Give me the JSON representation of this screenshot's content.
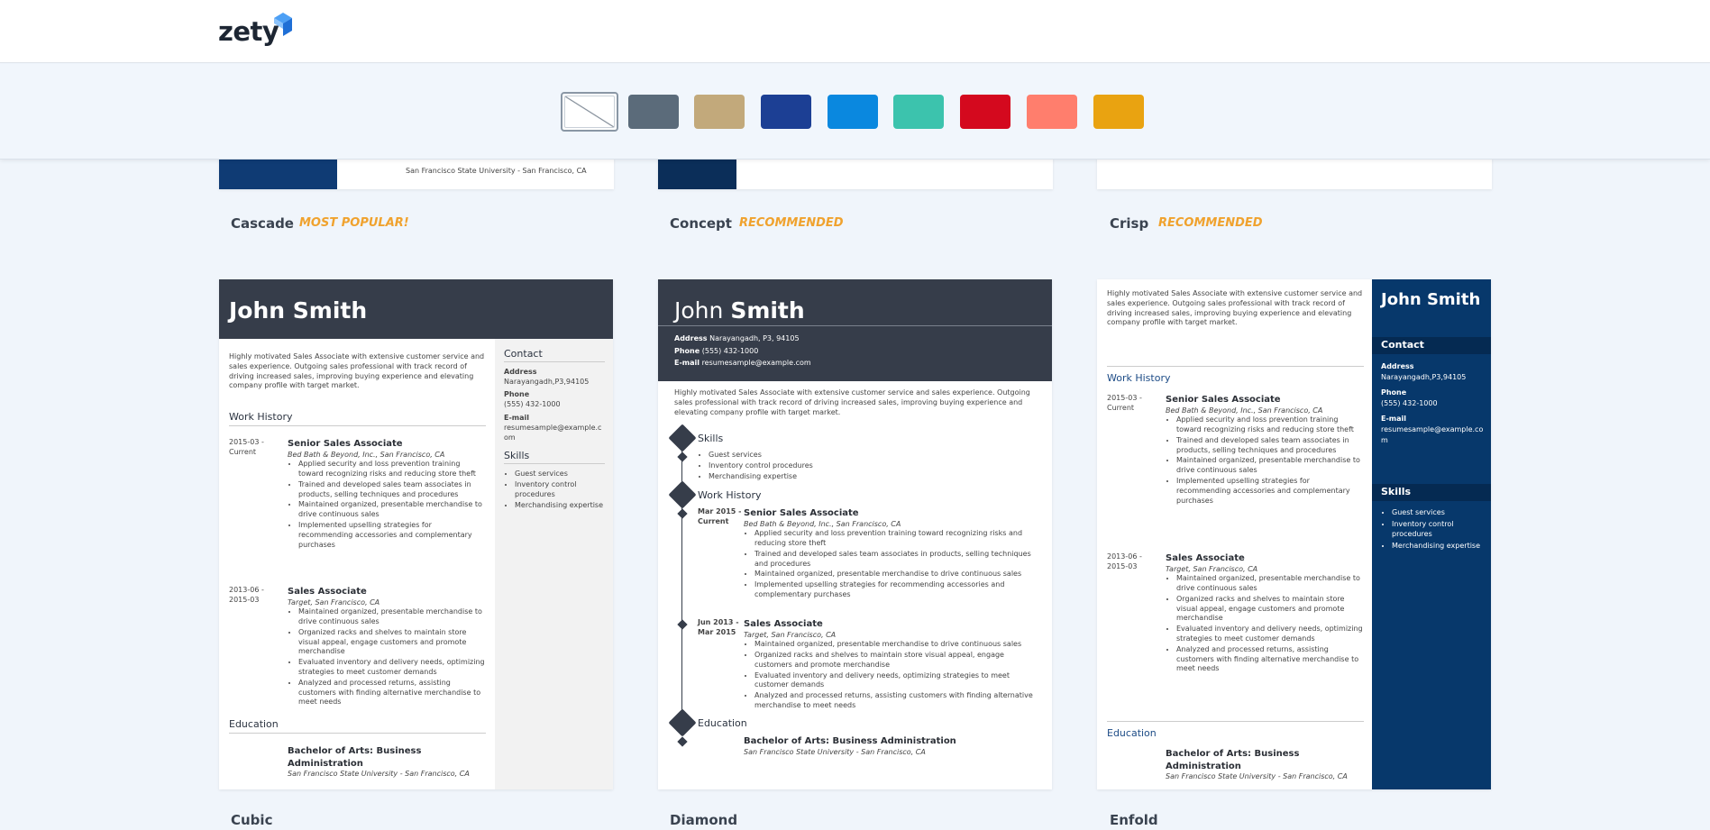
{
  "header": {
    "logo": "zety"
  },
  "colors": {
    "swatches": [
      "none",
      "#5b6b7a",
      "#c2a97b",
      "#1c3f94",
      "#0a88df",
      "#3cc3ad",
      "#d4091e",
      "#ff7e6d",
      "#e9a311"
    ],
    "accent": "#f0a22e",
    "dark": "#363d4a",
    "navy": "#07386b"
  },
  "templates_top": [
    {
      "name": "Cascade",
      "badge": "MOST POPULAR!",
      "snippet": "San Francisco State University - San Francisco, CA"
    },
    {
      "name": "Concept",
      "badge": "RECOMMENDED",
      "snippet": ""
    },
    {
      "name": "Crisp",
      "badge": "RECOMMENDED",
      "snippet": ""
    }
  ],
  "templates_bottom": [
    {
      "name": "Cubic"
    },
    {
      "name": "Diamond"
    },
    {
      "name": "Enfold"
    }
  ],
  "resume": {
    "first": "John",
    "last": "Smith",
    "full": "John Smith",
    "summary": "Highly motivated Sales Associate with extensive customer service and sales experience. Outgoing sales professional with track record of driving increased sales, improving buying experience and elevating company profile with target market.",
    "contact_h": "Contact",
    "address_l": "Address",
    "address": "Narayangadh,P3,94105",
    "address2": "Narayangadh, P3, 94105",
    "phone_l": "Phone",
    "phone": "(555) 432-1000",
    "email_l": "E-mail",
    "email": "resumesample@example.com",
    "skills_h": "Skills",
    "skills": [
      "Guest services",
      "Inventory control procedures",
      "Merchandising expertise"
    ],
    "work_h": "Work History",
    "edu_h": "Education",
    "job1": {
      "date1": "2015-03 -",
      "date2": "Current",
      "dateb1": "Mar 2015 -",
      "dateb2": "Current",
      "title": "Senior Sales Associate",
      "company": "Bed Bath & Beyond, Inc., San Francisco, CA",
      "bullets": [
        "Applied security and loss prevention training toward recognizing risks and reducing store theft",
        "Trained and developed sales team associates in products, selling techniques and procedures",
        "Maintained organized, presentable merchandise to drive continuous sales",
        "Implemented upselling strategies for recommending accessories and complementary purchases"
      ]
    },
    "job2": {
      "date1": "2013-06 -",
      "date2": "2015-03",
      "dateb1": "Jun 2013 -",
      "dateb2": "Mar 2015",
      "title": "Sales Associate",
      "company": "Target, San Francisco, CA",
      "bullets": [
        "Maintained organized, presentable merchandise to drive continuous sales",
        "Organized racks and shelves to maintain store visual appeal, engage customers and promote merchandise",
        "Evaluated inventory and delivery needs, optimizing strategies to meet customer demands",
        "Analyzed and processed returns, assisting customers with finding alternative merchandise to meet needs"
      ]
    },
    "degree": "Bachelor of Arts: Business Administration",
    "school": "San Francisco State University - San Francisco, CA"
  }
}
